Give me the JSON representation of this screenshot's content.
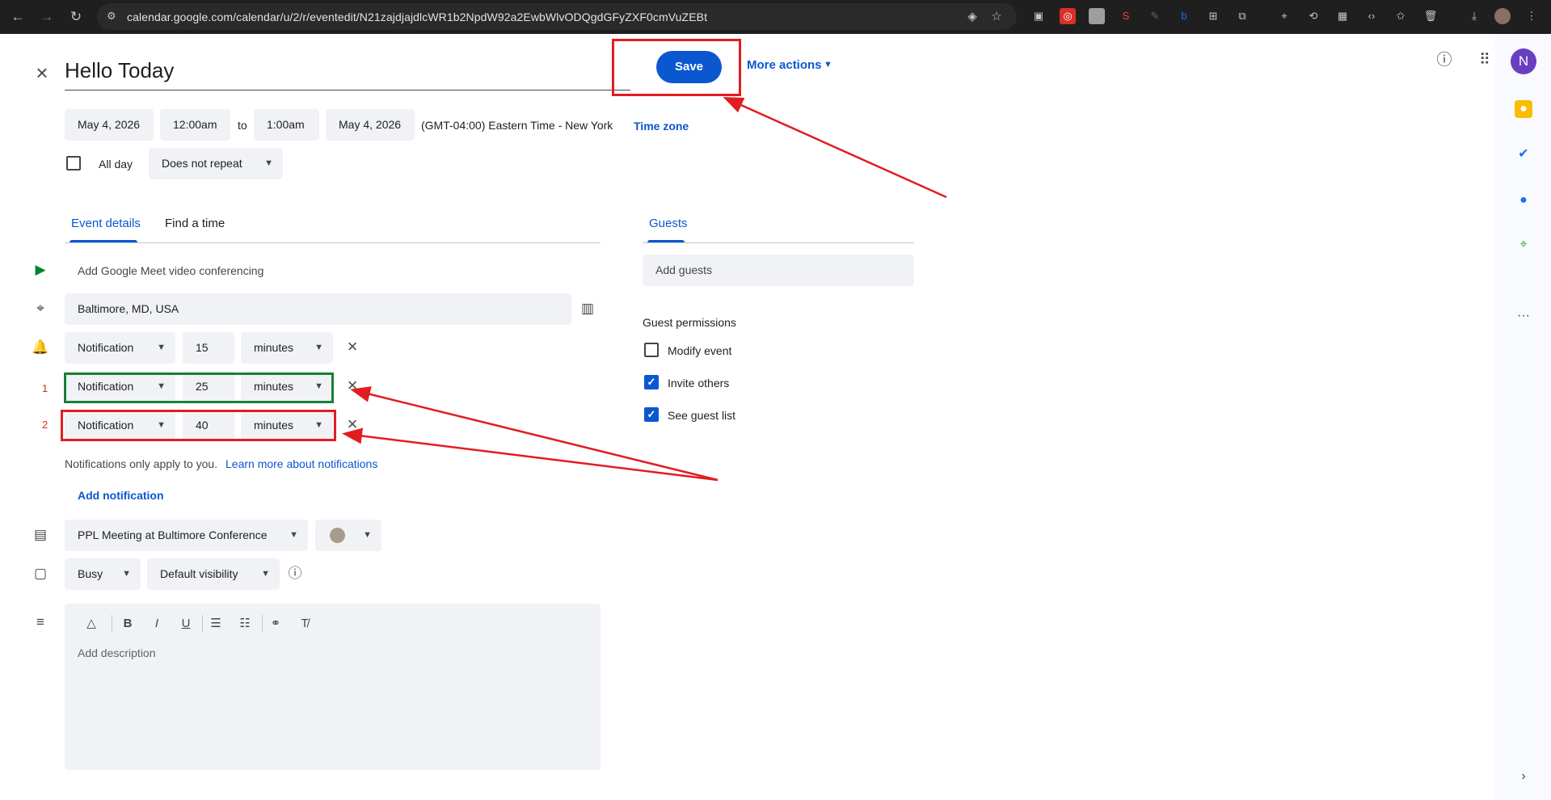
{
  "browser": {
    "url": "calendar.google.com/calendar/u/2/r/eventedit/N21zajdjajdlcWR1b2NpdW92a2EwbWlvODQgdGFyZXF0cmVuZEBt"
  },
  "event": {
    "title": "Hello Today",
    "save_label": "Save",
    "more_actions_label": "More actions",
    "start_date": "May 4, 2026",
    "start_time": "12:00am",
    "to_label": "to",
    "end_time": "1:00am",
    "end_date": "May 4, 2026",
    "timezone_text": "(GMT-04:00) Eastern Time - New York",
    "timezone_link": "Time zone",
    "all_day_label": "All day",
    "repeat_value": "Does not repeat"
  },
  "tabs": {
    "details": "Event details",
    "find_time": "Find a time",
    "guests": "Guests"
  },
  "details": {
    "meet_label": "Add Google Meet video conferencing",
    "location_value": "Baltimore, MD, USA",
    "notifications": [
      {
        "type": "Notification",
        "value": "15",
        "unit": "minutes"
      },
      {
        "type": "Notification",
        "value": "25",
        "unit": "minutes"
      },
      {
        "type": "Notification",
        "value": "40",
        "unit": "minutes"
      }
    ],
    "notif_note": "Notifications only apply to you.",
    "notif_learn_more": "Learn more about notifications",
    "add_notification": "Add notification",
    "calendar_value": "PPL Meeting at Bultimore Conference",
    "busy_value": "Busy",
    "visibility_value": "Default visibility",
    "description_placeholder": "Add description"
  },
  "guests": {
    "add_placeholder": "Add guests",
    "permissions_title": "Guest permissions",
    "permissions": [
      {
        "label": "Modify event",
        "checked": false
      },
      {
        "label": "Invite others",
        "checked": true
      },
      {
        "label": "See guest list",
        "checked": true
      }
    ]
  },
  "annotations": {
    "label_1": "1",
    "label_2": "2"
  },
  "colors": {
    "accent": "#0b57d0",
    "annotation_red": "#e11d22",
    "annotation_green": "#188038",
    "event_color": "#a79b8e"
  }
}
